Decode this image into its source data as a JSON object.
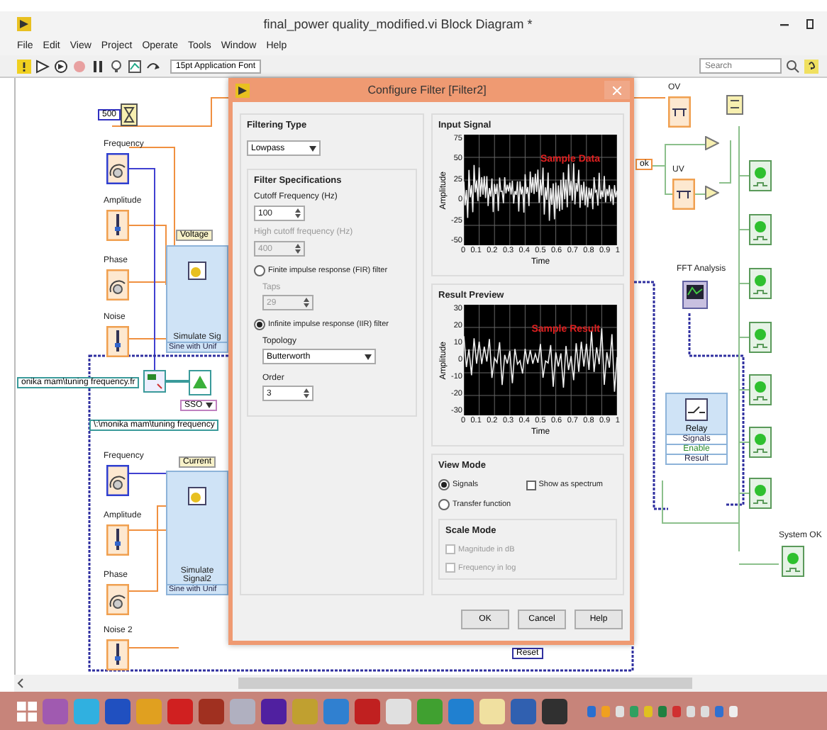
{
  "window": {
    "title": "final_power quality_modified.vi Block Diagram *"
  },
  "menu": [
    "File",
    "Edit",
    "View",
    "Project",
    "Operate",
    "Tools",
    "Window",
    "Help"
  ],
  "toolbar": {
    "font": "15pt Application Font",
    "search": {
      "placeholder": "Search"
    }
  },
  "diagram": {
    "wait_constant": "500",
    "voltage": {
      "title": "Voltage",
      "vi_name": "Simulate Sig",
      "vi_mode": "Sine with Unif",
      "controls": [
        {
          "label": "Frequency",
          "kind": "dial"
        },
        {
          "label": "Amplitude",
          "kind": "slider"
        },
        {
          "label": "Phase",
          "kind": "knob"
        },
        {
          "label": "Noise",
          "kind": "slider"
        }
      ]
    },
    "file_path_in": "onika mam\\tuning frequency.fr",
    "enum": "SSO",
    "file_path_out": "\\:\\monika mam\\tuning frequency",
    "current": {
      "title": "Current",
      "vi_name": "Simulate Signal2",
      "vi_mode": "Sine with Unif",
      "controls": [
        {
          "label": "Frequency",
          "kind": "dial"
        },
        {
          "label": "Amplitude",
          "kind": "slider"
        },
        {
          "label": "Phase",
          "kind": "knob"
        },
        {
          "label": "Noise 2",
          "kind": "slider"
        }
      ]
    },
    "ok_tag": "ok",
    "limits": [
      "OV",
      "UV"
    ],
    "fft": "FFT Analysis",
    "relay": {
      "name": "Relay",
      "terminals": [
        "Signals",
        "Enable",
        "Result"
      ]
    },
    "system_ok": "System OK",
    "reset": "Reset"
  },
  "dialog": {
    "title": "Configure Filter [Filter2]",
    "filtering_type": {
      "heading": "Filtering Type",
      "value": "Lowpass"
    },
    "filter_specs": {
      "heading": "Filter Specifications",
      "fields": [
        {
          "label": "Cutoff Frequency (Hz)",
          "value": "100",
          "disabled": false
        },
        {
          "label": "High cutoff frequency (Hz)",
          "value": "400",
          "disabled": true
        }
      ],
      "fir": {
        "label": "Finite impulse response (FIR) filter",
        "selected": false,
        "taps": {
          "label": "Taps",
          "value": "29",
          "disabled": true
        }
      },
      "iir": {
        "label": "Infinite impulse response (IIR) filter",
        "selected": true,
        "topology": {
          "label": "Topology",
          "value": "Butterworth"
        },
        "order": {
          "label": "Order",
          "value": "3"
        }
      }
    },
    "input_signal": {
      "heading": "Input Signal",
      "ylabel": "Amplitude",
      "xlabel": "Time",
      "legend": "Sample Data",
      "yticks": [
        "75",
        "50",
        "25",
        "0",
        "-25",
        "-50"
      ],
      "xticks": [
        "0",
        "0.1",
        "0.2",
        "0.3",
        "0.4",
        "0.5",
        "0.6",
        "0.7",
        "0.8",
        "0.9",
        "1"
      ]
    },
    "result_preview": {
      "heading": "Result Preview",
      "ylabel": "Amplitude",
      "xlabel": "Time",
      "legend": "Sample Result",
      "yticks": [
        "30",
        "20",
        "10",
        "0",
        "-10",
        "-20",
        "-30"
      ],
      "xticks": [
        "0",
        "0.1",
        "0.2",
        "0.3",
        "0.4",
        "0.5",
        "0.6",
        "0.7",
        "0.8",
        "0.9",
        "1"
      ]
    },
    "view_mode": {
      "heading": "View Mode",
      "options": [
        {
          "label": "Signals",
          "selected": true
        },
        {
          "label": "Transfer function",
          "selected": false
        }
      ],
      "show_spectrum": {
        "label": "Show as spectrum",
        "checked": false
      },
      "scale_mode": {
        "heading": "Scale Mode",
        "disabled": true,
        "options": [
          {
            "label": "Magnitude in dB",
            "checked": false
          },
          {
            "label": "Frequency in log",
            "checked": false
          }
        ]
      }
    },
    "buttons": [
      "OK",
      "Cancel",
      "Help"
    ]
  }
}
